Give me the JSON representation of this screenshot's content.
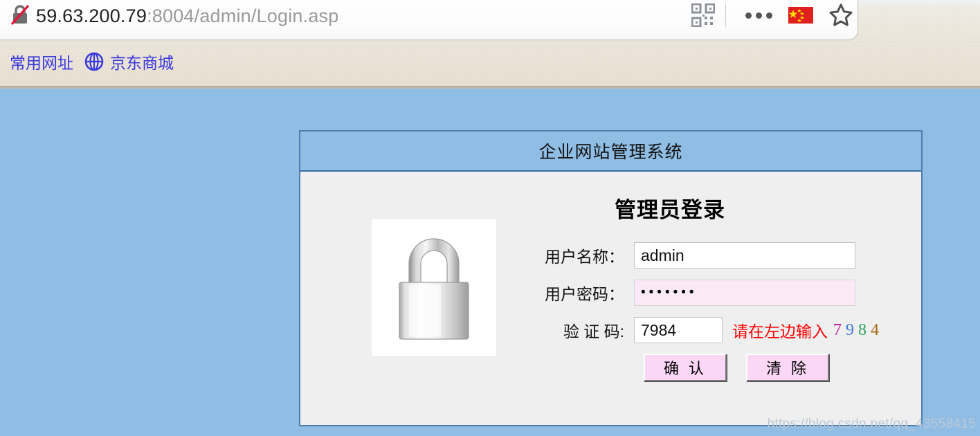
{
  "browser": {
    "security_icon": "broken-lock-icon",
    "url_host": "59.63.200.79",
    "url_path": ":8004/admin/Login.asp",
    "qr_icon": "qr-code-icon",
    "more_icon": "more-options-icon",
    "flag_icon": "china-flag-icon",
    "bookmark_star_icon": "star-icon",
    "bookmarks": [
      {
        "label": "常用网址",
        "icon": ""
      },
      {
        "label": "京东商城",
        "icon": "globe-icon"
      }
    ]
  },
  "page": {
    "background_color": "#8FBDE4",
    "panel": {
      "header_title": "企业网站管理系统",
      "border_color": "#4E7CAE",
      "body_color": "#EFEFEF",
      "form_title": "管理员登录",
      "padlock_icon": "padlock-icon",
      "fields": {
        "username": {
          "label": "用户名称：",
          "value": "admin",
          "placeholder": ""
        },
        "password": {
          "label": "用户密码：",
          "value": "•••••••",
          "placeholder": ""
        },
        "captcha": {
          "label": "验 证 码:",
          "value": "7984",
          "placeholder": ""
        }
      },
      "captcha_hint": {
        "text": "请在左边输入",
        "color": "#FF0000",
        "digits": [
          {
            "char": "7",
            "color": "#B5179E"
          },
          {
            "char": "9",
            "color": "#3A7BD5"
          },
          {
            "char": "8",
            "color": "#2BA45F"
          },
          {
            "char": "4",
            "color": "#A8690C"
          }
        ]
      },
      "buttons": {
        "submit_label": "确 认",
        "clear_label": "清 除"
      }
    },
    "watermark": "https://blog.csdn.net/qq_43558415"
  }
}
